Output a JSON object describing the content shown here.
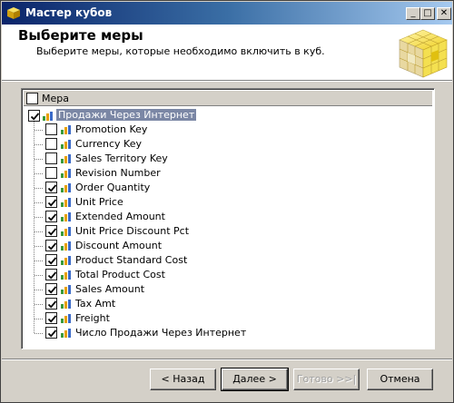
{
  "window": {
    "title": "Мастер кубов",
    "minimize": "_",
    "maximize": "□",
    "close": "✕"
  },
  "header": {
    "title": "Выберите меры",
    "subtitle": "Выберите меры, которые необходимо включить в куб."
  },
  "tree": {
    "column_header": "Мера",
    "column_checked": false,
    "root": {
      "label": "Продажи Через Интернет",
      "checked": true
    },
    "items": [
      {
        "label": "Promotion Key",
        "checked": false
      },
      {
        "label": "Currency Key",
        "checked": false
      },
      {
        "label": "Sales Territory Key",
        "checked": false
      },
      {
        "label": "Revision Number",
        "checked": false
      },
      {
        "label": "Order Quantity",
        "checked": true
      },
      {
        "label": "Unit Price",
        "checked": true
      },
      {
        "label": "Extended Amount",
        "checked": true
      },
      {
        "label": "Unit Price Discount Pct",
        "checked": true
      },
      {
        "label": "Discount Amount",
        "checked": true
      },
      {
        "label": "Product Standard Cost",
        "checked": true
      },
      {
        "label": "Total Product Cost",
        "checked": true
      },
      {
        "label": "Sales Amount",
        "checked": true
      },
      {
        "label": "Tax Amt",
        "checked": true
      },
      {
        "label": "Freight",
        "checked": true
      },
      {
        "label": "Число Продажи Через Интернет",
        "checked": true
      }
    ]
  },
  "buttons": {
    "back": "< Назад",
    "next": "Далее >",
    "finish": "Готово >>|",
    "cancel": "Отмена"
  },
  "colors": {
    "title_gradient_start": "#0a246a",
    "title_gradient_end": "#a6caf0",
    "selection": "#7b87a5",
    "cube_yellow": "#f0d020"
  }
}
